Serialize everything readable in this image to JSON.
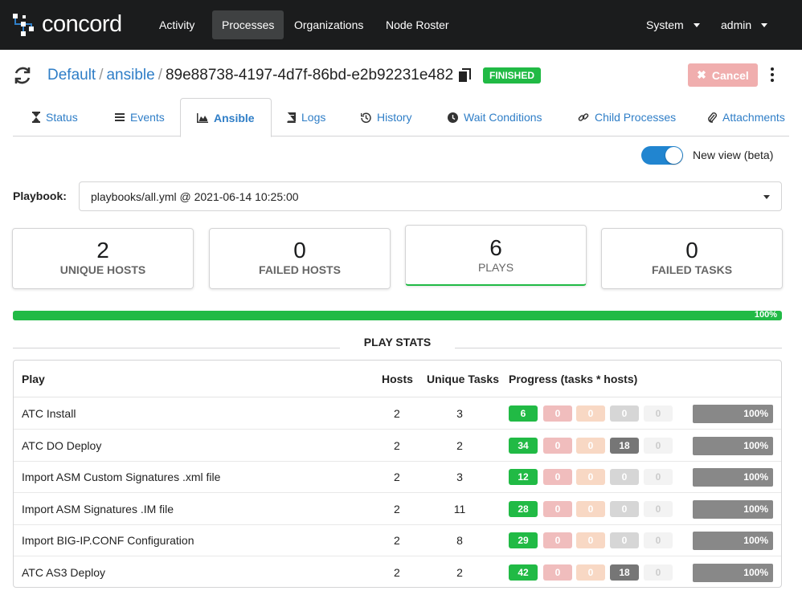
{
  "brand": {
    "name": "concord"
  },
  "nav": {
    "items": [
      {
        "label": "Activity"
      },
      {
        "label": "Processes"
      },
      {
        "label": "Organizations"
      },
      {
        "label": "Node Roster"
      }
    ],
    "system_label": "System",
    "user_label": "admin"
  },
  "header": {
    "org": "Default",
    "project": "ansible",
    "separator": "/",
    "process_id": "89e88738-4197-4d7f-86bd-e2b92231e482",
    "status": "FINISHED",
    "cancel_label": "Cancel"
  },
  "tabs": [
    {
      "label": "Status",
      "icon": "hourglass-icon"
    },
    {
      "label": "Events",
      "icon": "list-icon"
    },
    {
      "label": "Ansible",
      "icon": "chart-area-icon"
    },
    {
      "label": "Logs",
      "icon": "book-icon"
    },
    {
      "label": "History",
      "icon": "history-icon"
    },
    {
      "label": "Wait Conditions",
      "icon": "clock-icon"
    },
    {
      "label": "Child Processes",
      "icon": "linkify-icon"
    },
    {
      "label": "Attachments",
      "icon": "paperclip-icon"
    }
  ],
  "toggle": {
    "label": "New view (beta)",
    "on": true
  },
  "playbook": {
    "label": "Playbook:",
    "selected": "playbooks/all.yml @ 2021-06-14 10:25:00"
  },
  "stats": [
    {
      "value": "2",
      "label": "UNIQUE HOSTS"
    },
    {
      "value": "0",
      "label": "FAILED HOSTS"
    },
    {
      "value": "6",
      "label": "PLAYS"
    },
    {
      "value": "0",
      "label": "FAILED TASKS"
    }
  ],
  "overall_progress": {
    "value": 100,
    "label": "100%"
  },
  "play_stats": {
    "title": "PLAY STATS",
    "columns": [
      "Play",
      "Hosts",
      "Unique Tasks",
      "Progress (tasks * hosts)"
    ],
    "rows": [
      {
        "play": "ATC Install",
        "hosts": "2",
        "tasks": "3",
        "counts": [
          "6",
          "0",
          "0",
          "0",
          "0"
        ],
        "progress": "100%"
      },
      {
        "play": "ATC DO Deploy",
        "hosts": "2",
        "tasks": "2",
        "counts": [
          "34",
          "0",
          "0",
          "18",
          "0"
        ],
        "progress": "100%"
      },
      {
        "play": "Import ASM Custom Signatures .xml file",
        "hosts": "2",
        "tasks": "3",
        "counts": [
          "12",
          "0",
          "0",
          "0",
          "0"
        ],
        "progress": "100%"
      },
      {
        "play": "Import ASM Signatures .IM file",
        "hosts": "2",
        "tasks": "11",
        "counts": [
          "28",
          "0",
          "0",
          "0",
          "0"
        ],
        "progress": "100%"
      },
      {
        "play": "Import BIG-IP.CONF Configuration",
        "hosts": "2",
        "tasks": "8",
        "counts": [
          "29",
          "0",
          "0",
          "0",
          "0"
        ],
        "progress": "100%"
      },
      {
        "play": "ATC AS3 Deploy",
        "hosts": "2",
        "tasks": "2",
        "counts": [
          "42",
          "0",
          "0",
          "18",
          "0"
        ],
        "progress": "100%"
      }
    ]
  },
  "colors": {
    "nav_bg": "#1b1c1d",
    "link": "#2f7ec7",
    "ok": "#21ba45",
    "failed": "#f0bdbd",
    "unreachable": "#f8d8c4",
    "skipped_zero": "#d6d6d6",
    "skipped": "#767676",
    "running": "#f3f3f3",
    "progress_bar": "#888888"
  }
}
